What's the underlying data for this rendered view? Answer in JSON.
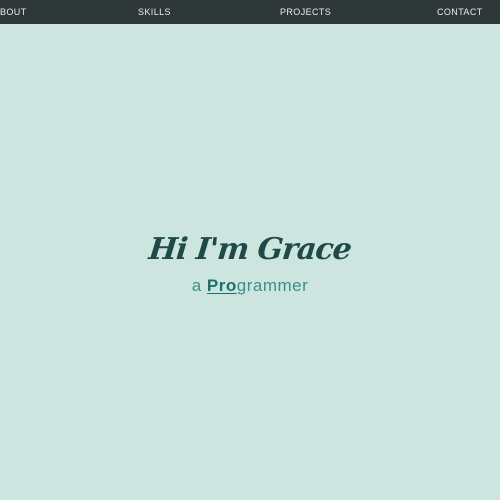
{
  "nav": {
    "items": [
      {
        "label": "BOUT"
      },
      {
        "label": "SKILLS"
      },
      {
        "label": "PROJECTS"
      },
      {
        "label": "CONTACT"
      }
    ]
  },
  "hero": {
    "title": "Hi I'm Grace",
    "subtitle_prefix": "a ",
    "subtitle_emphasis": "Pro",
    "subtitle_suffix": "grammer"
  },
  "colors": {
    "background": "#cce5df",
    "navbar": "#2e3838",
    "nav_text": "#e8efee",
    "title": "#1f4a48",
    "subtitle": "#3f8f89",
    "emphasis": "#1f6f70"
  }
}
